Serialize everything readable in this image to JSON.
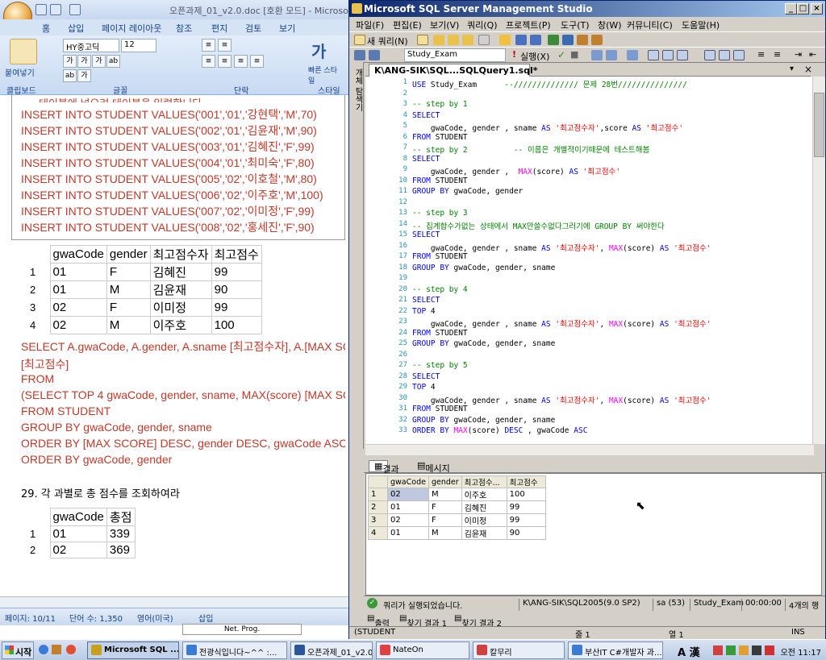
{
  "word": {
    "title": "오픈과제_01_v2.0.doc [호환 모드] - Microsoft Word",
    "tabs": [
      "홈",
      "삽입",
      "페이지 레이아웃",
      "참조",
      "편지",
      "검토",
      "보기"
    ],
    "font_name": "HY중고딕",
    "font_size": "12",
    "groups": {
      "clipboard": "클립보드",
      "font": "글꼴",
      "paragraph": "단락",
      "styles": "스타일"
    },
    "paste_label": "붙여넣기",
    "quick_style_label": "빠른 스타일",
    "cut_line": "테이블에 넣으려 테이블을 입력합니다.",
    "insert_lines": [
      "INSERT INTO STUDENT VALUES('001','01','강현택','M',70)",
      "INSERT INTO STUDENT VALUES('002','01','김윤재','M',90)",
      "INSERT INTO STUDENT VALUES('003','01','김혜진','F',99)",
      "INSERT INTO STUDENT VALUES('004','01','최미숙','F',80)",
      "INSERT INTO STUDENT VALUES('005','02','이호철','M',80)",
      "INSERT INTO STUDENT VALUES('006','02','이주호','M',100)",
      "INSERT INTO STUDENT VALUES('007','02','이미정','F',99)",
      "INSERT INTO STUDENT VALUES('008','02','홍세진','F',90)"
    ],
    "table1": {
      "headers": [
        "gwaCode",
        "gender",
        "최고점수자",
        "최고점수"
      ],
      "rows": [
        [
          "1",
          "01",
          "F",
          "김혜진",
          "99"
        ],
        [
          "2",
          "01",
          "M",
          "김윤재",
          "90"
        ],
        [
          "3",
          "02",
          "F",
          "이미정",
          "99"
        ],
        [
          "4",
          "02",
          "M",
          "이주호",
          "100"
        ]
      ]
    },
    "sql_lines": [
      "SELECT A.gwaCode, A.gender, A.sname [최고점수자], A.[MAX SCORE]",
      "[최고점수]",
      "FROM",
      "(SELECT TOP 4 gwaCode, gender, sname, MAX(score) [MAX SCORE]",
      "FROM STUDENT",
      "GROUP BY gwaCode, gender, sname",
      "ORDER BY [MAX SCORE] DESC, gender DESC, gwaCode ASC",
      "ORDER BY gwaCode, gender"
    ],
    "question": "29. 각 과별로 총 점수를 조회하여라",
    "table2": {
      "headers": [
        "gwaCode",
        "총점"
      ],
      "rows": [
        [
          "1",
          "01",
          "339"
        ],
        [
          "2",
          "02",
          "369"
        ]
      ]
    },
    "status": {
      "page": "페이지: 10/11",
      "words": "단어 수: 1,350",
      "lang": "영어(미국)",
      "mode": "삽입"
    },
    "net_prog": "Net. Prog."
  },
  "ssms": {
    "title": "Microsoft SQL Server Management Studio",
    "menu": [
      "파일(F)",
      "편집(E)",
      "보기(V)",
      "쿼리(Q)",
      "프로젝트(P)",
      "도구(T)",
      "창(W)",
      "커뮤니티(C)",
      "도움말(H)"
    ],
    "new_query": "새 쿼리(N)",
    "database": "Study_Exam",
    "execute": "실행(X)",
    "side_label": "개체 탐색기",
    "editor_tab": "K\\ANG-SIK\\SQL...SQLQuery1.sql*",
    "code_lines": [
      {
        "n": "1",
        "html": "<span class=\"kw\">USE</span> Study_Exam      <span class=\"cm\">--////////////// 문제 28번///////////////</span>"
      },
      {
        "n": "2",
        "html": ""
      },
      {
        "n": "3",
        "html": "<span class=\"cm\">-- step by 1</span>"
      },
      {
        "n": "4",
        "html": "<span class=\"kw\">SELECT</span>"
      },
      {
        "n": "5",
        "html": "    gwaCode, gender , sname <span class=\"kw\">AS</span> <span class=\"str\">'최고점수자'</span>,score <span class=\"kw\">AS</span> <span class=\"str\">'최고점수'</span>"
      },
      {
        "n": "6",
        "html": "<span class=\"kw\">FROM</span> STUDENT"
      },
      {
        "n": "7",
        "html": "<span class=\"cm\">-- step by 2          -- 이름은 개별적이기때문에 테스트해봄</span>"
      },
      {
        "n": "8",
        "html": "<span class=\"kw\">SELECT</span>"
      },
      {
        "n": "9",
        "html": "    gwaCode, gender ,  <span class=\"fn\">MAX</span>(score) <span class=\"kw\">AS</span> <span class=\"str\">'최고점수'</span>"
      },
      {
        "n": "10",
        "html": "<span class=\"kw\">FROM</span> STUDENT"
      },
      {
        "n": "11",
        "html": "<span class=\"kw\">GROUP BY</span> gwaCode, gender"
      },
      {
        "n": "12",
        "html": ""
      },
      {
        "n": "13",
        "html": "<span class=\"cm\">-- step by 3</span>"
      },
      {
        "n": "14",
        "html": "<span class=\"cm\">-- 집계합수가없는 상태에서 MAX만쓸수없다그러기에 GROUP BY 써야한다</span>"
      },
      {
        "n": "15",
        "html": "<span class=\"kw\">SELECT</span>"
      },
      {
        "n": "16",
        "html": "    gwaCode, gender , sname <span class=\"kw\">AS</span> <span class=\"str\">'최고점수자'</span>, <span class=\"fn\">MAX</span>(score) <span class=\"kw\">AS</span> <span class=\"str\">'최고점수'</span>"
      },
      {
        "n": "17",
        "html": "<span class=\"kw\">FROM</span> STUDENT"
      },
      {
        "n": "18",
        "html": "<span class=\"kw\">GROUP BY</span> gwaCode, gender, sname"
      },
      {
        "n": "19",
        "html": ""
      },
      {
        "n": "20",
        "html": "<span class=\"cm\">-- step by 4</span>"
      },
      {
        "n": "21",
        "html": "<span class=\"kw\">SELECT</span>"
      },
      {
        "n": "22",
        "html": "<span class=\"kw\">TOP</span> 4"
      },
      {
        "n": "23",
        "html": "    gwaCode, gender , sname <span class=\"kw\">AS</span> <span class=\"str\">'최고점수자'</span>, <span class=\"fn\">MAX</span>(score) <span class=\"kw\">AS</span> <span class=\"str\">'최고점수'</span>"
      },
      {
        "n": "24",
        "html": "<span class=\"kw\">FROM</span> STUDENT"
      },
      {
        "n": "25",
        "html": "<span class=\"kw\">GROUP BY</span> gwaCode, gender, sname"
      },
      {
        "n": "26",
        "html": ""
      },
      {
        "n": "27",
        "html": "<span class=\"cm\">-- step by 5</span>"
      },
      {
        "n": "28",
        "html": "<span class=\"kw\">SELECT</span>"
      },
      {
        "n": "29",
        "html": "<span class=\"kw\">TOP</span> 4"
      },
      {
        "n": "30",
        "html": "    gwaCode, gender , sname <span class=\"kw\">AS</span> <span class=\"str\">'최고점수자'</span>, <span class=\"fn\">MAX</span>(score) <span class=\"kw\">AS</span> <span class=\"str\">'최고점수'</span>"
      },
      {
        "n": "31",
        "html": "<span class=\"kw\">FROM</span> STUDENT"
      },
      {
        "n": "32",
        "html": "<span class=\"kw\">GROUP BY</span> gwaCode, gender, sname"
      },
      {
        "n": "33",
        "html": "<span class=\"kw\">ORDER BY</span> <span class=\"fn\">MAX</span>(score) <span class=\"kw\">DESC</span> , gwaCode <span class=\"kw\">ASC</span>"
      }
    ],
    "result_tabs": {
      "results": "결과",
      "messages": "메시지"
    },
    "grid": {
      "headers": [
        "gwaCode",
        "gender",
        "최고점수...",
        "최고점수"
      ],
      "rows": [
        [
          "1",
          "02",
          "M",
          "이주호",
          "100"
        ],
        [
          "2",
          "01",
          "F",
          "김혜진",
          "99"
        ],
        [
          "3",
          "02",
          "F",
          "이미정",
          "99"
        ],
        [
          "4",
          "01",
          "M",
          "김윤재",
          "90"
        ]
      ]
    },
    "qstatus": {
      "msg": "쿼리가 실행되었습니다.",
      "server": "K\\ANG-SIK\\SQL2005(9.0 SP2)",
      "user": "sa (53)",
      "db": "Study_Exam",
      "time": "00:00:00",
      "rows": "4개의 행"
    },
    "out_tabs": [
      "출력",
      "찾기 결과 1",
      "찾기 결과 2"
    ],
    "status": {
      "left": "(STUDENT",
      "line": "줄 1",
      "col": "열 1",
      "ins": "INS"
    }
  },
  "taskbar": {
    "start": "시작",
    "items": [
      {
        "label": "Microsoft SQL ...",
        "active": true,
        "color": "#c8a020"
      },
      {
        "label": "전광식입니다~^^ :...",
        "active": false,
        "color": "#3a7bd5"
      },
      {
        "label": "오픈과제_01_v2.0.d...",
        "active": false,
        "color": "#2b579a"
      },
      {
        "label": "NateOn",
        "active": false,
        "color": "#e04040"
      },
      {
        "label": "칼무리",
        "active": false,
        "color": "#d04040"
      },
      {
        "label": "부산IT C#개발자 과...",
        "active": false,
        "color": "#3a7bd5"
      }
    ],
    "clock": "오전 11:17"
  }
}
